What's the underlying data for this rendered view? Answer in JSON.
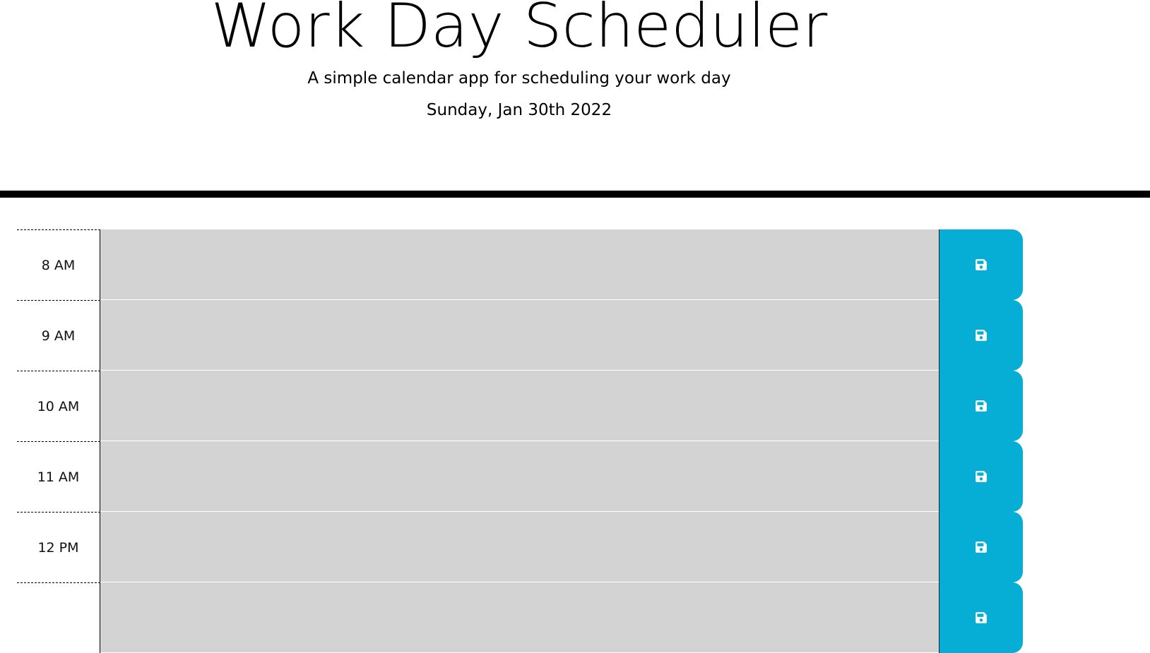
{
  "header": {
    "title": "Work Day Scheduler",
    "subtitle": "A simple calendar app for scheduling your work day",
    "current_date": "Sunday, Jan 30th 2022"
  },
  "theme": {
    "past_color": "#d3d3d3",
    "save_button_color": "#06aed5"
  },
  "schedule": {
    "rows": [
      {
        "hour": "8 AM",
        "description": "",
        "save_icon": "save-icon"
      },
      {
        "hour": "9 AM",
        "description": "",
        "save_icon": "save-icon"
      },
      {
        "hour": "10 AM",
        "description": "",
        "save_icon": "save-icon"
      },
      {
        "hour": "11 AM",
        "description": "",
        "save_icon": "save-icon"
      },
      {
        "hour": "12 PM",
        "description": "",
        "save_icon": "save-icon"
      },
      {
        "hour": "",
        "description": "",
        "save_icon": "save-icon"
      }
    ]
  }
}
